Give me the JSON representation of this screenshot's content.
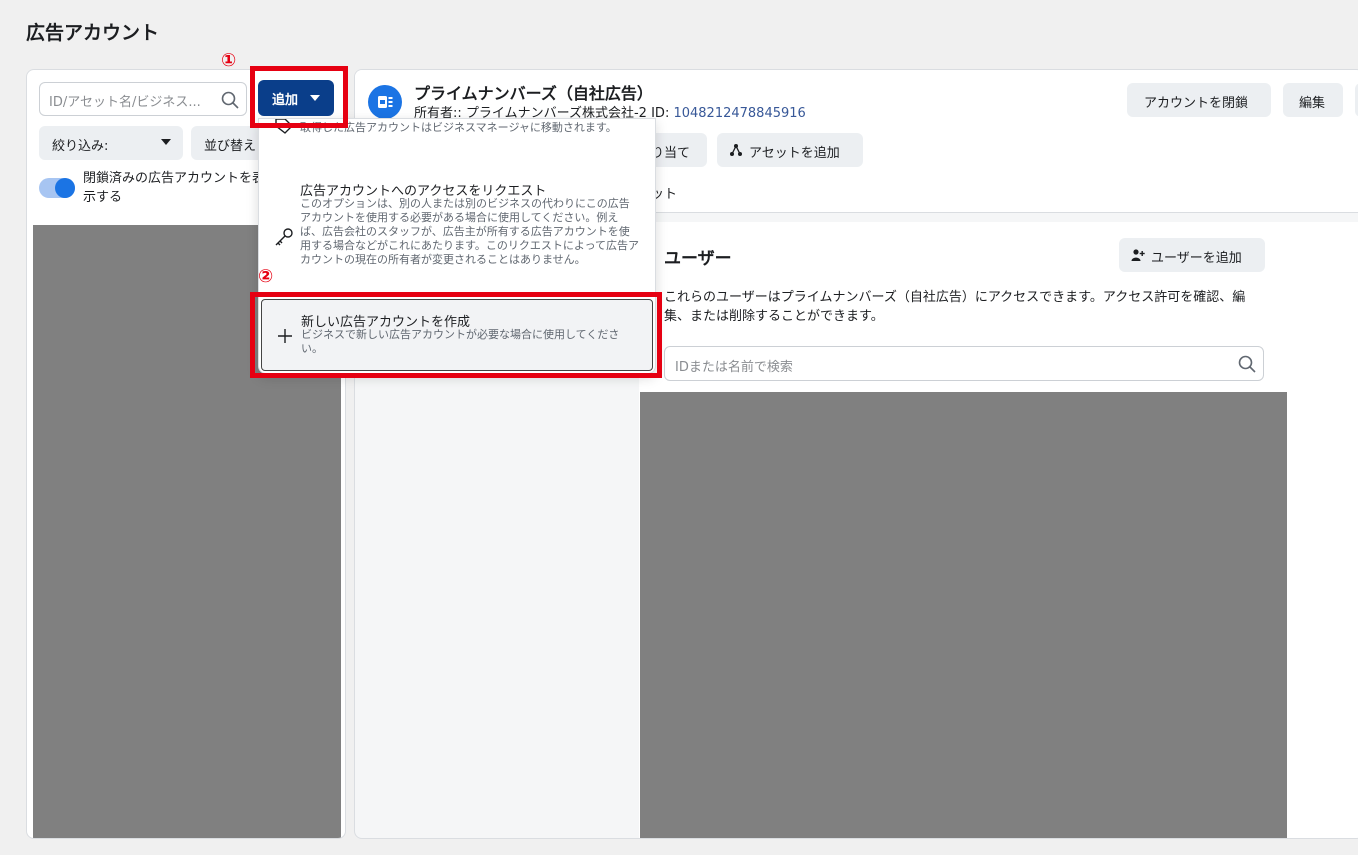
{
  "page": {
    "title": "広告アカウント"
  },
  "left_panel": {
    "search_placeholder": "ID/アセット名/ビジネス...",
    "add_button_label": "追加",
    "filter_label": "絞り込み:",
    "sort_label": "並び替え",
    "toggle_label": "閉鎖済みの広告アカウントを表示する",
    "toggle_on": true
  },
  "account": {
    "name": "プライムナンバーズ（自社広告）",
    "owner_prefix": "所有者:: プライムナンバーズ株式会社-2",
    "id_label": "ID:",
    "id_value": "1048212478845916",
    "close_button": "アカウントを閉鎖",
    "edit_button": "編集",
    "assign_button": "り当て",
    "add_asset_button": "アセットを追加",
    "asset_tab": "セット"
  },
  "users": {
    "title": "ユーザー",
    "add_user_button": "ユーザーを追加",
    "description": "これらのユーザーはプライムナンバーズ（自社広告）にアクセスできます。アクセス許可を確認、編集、または削除することができます。",
    "search_placeholder": "IDまたは名前で検索"
  },
  "dropdown": {
    "items": [
      {
        "title": "",
        "description": "ビジネスがこの広告アカウントのキャンペーンと請求を管理します。取得した広告アカウントはビジネスマネージャに移動されます。",
        "icon": "tag-icon"
      },
      {
        "title": "広告アカウントへのアクセスをリクエスト",
        "description": "このオプションは、別の人または別のビジネスの代わりにこの広告アカウントを使用する必要がある場合に使用してください。例えば、広告会社のスタッフが、広告主が所有する広告アカウントを使用する場合などがこれにあたります。このリクエストによって広告アカウントの現在の所有者が変更されることはありません。",
        "icon": "key-icon"
      },
      {
        "title": "新しい広告アカウントを作成",
        "description": "ビジネスで新しい広告アカウントが必要な場合に使用してください。",
        "icon": "plus-icon"
      }
    ]
  },
  "annotations": {
    "step1": "①",
    "step2": "②"
  },
  "colors": {
    "accent": "#1b74e4",
    "primary_button": "#0a3e8a",
    "annotation_red": "#e60012",
    "redacted": "#808080"
  }
}
